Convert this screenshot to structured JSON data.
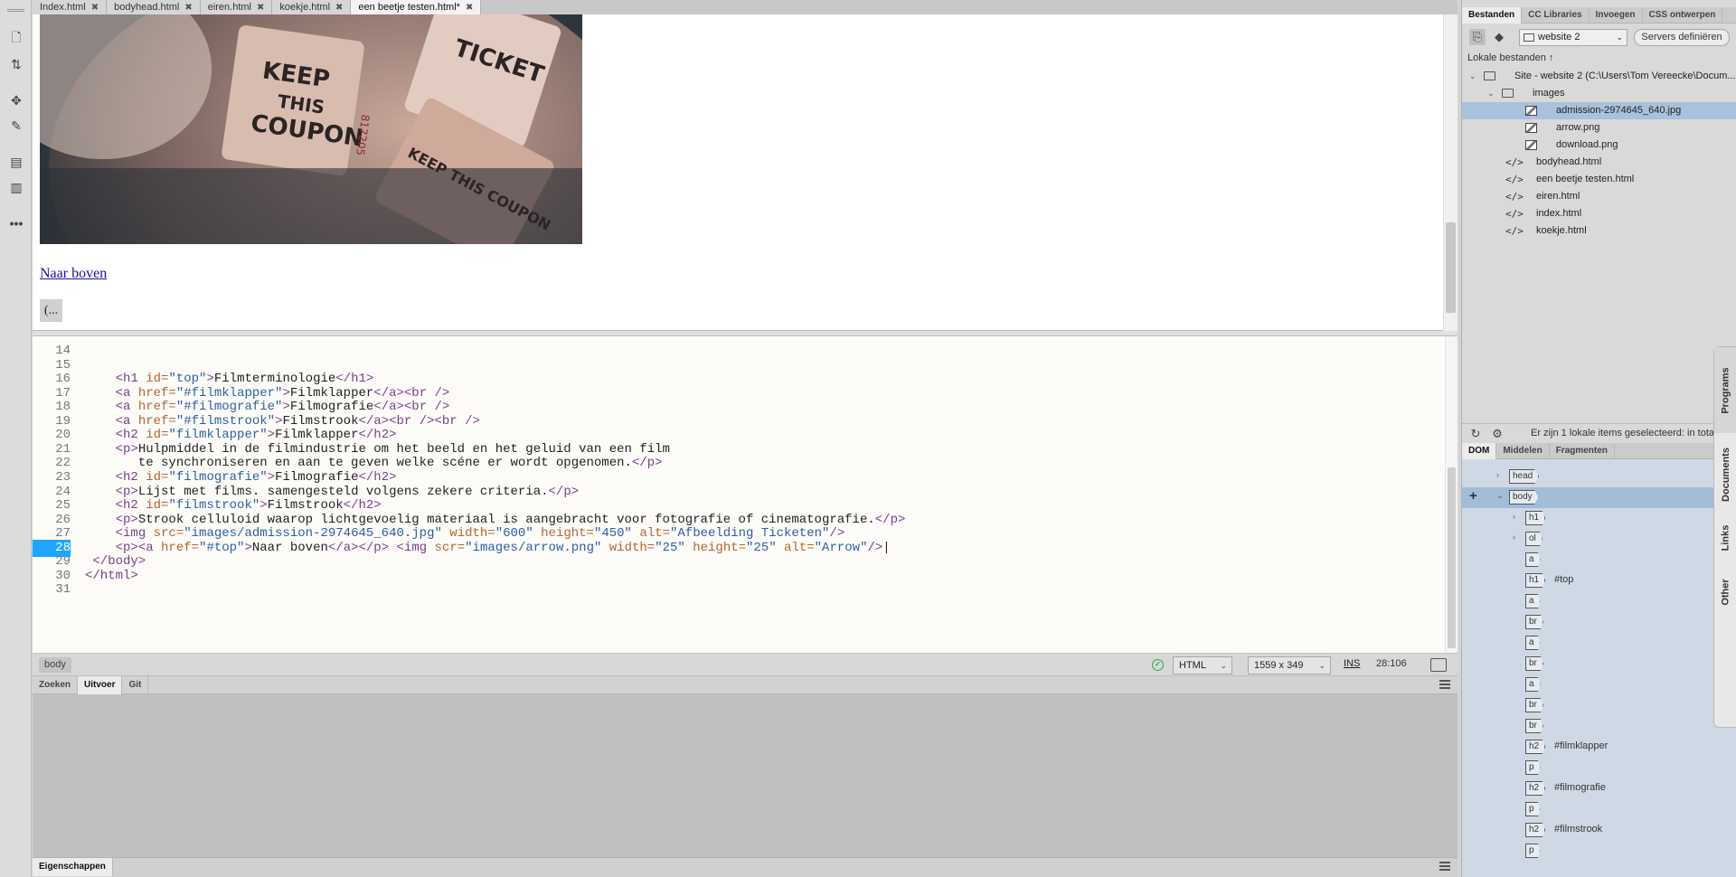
{
  "doc_tabs": [
    {
      "label": "Index.html",
      "active": false
    },
    {
      "label": "bodyhead.html",
      "active": false
    },
    {
      "label": "eiren.html",
      "active": false
    },
    {
      "label": "koekje.html",
      "active": false
    },
    {
      "label": "een beetje testen.html*",
      "active": true
    }
  ],
  "live": {
    "image_alt": "Afbeelding Ticketen",
    "image_text": [
      "KEEP",
      "THIS",
      "COUPON",
      "TICKET",
      "KEEP THIS COUPON",
      "817205"
    ],
    "link_text": "Naar boven",
    "arrow_button_text": "(..."
  },
  "code": {
    "lines": [
      {
        "n": "14",
        "html": ""
      },
      {
        "n": "15",
        "html": ""
      },
      {
        "n": "16",
        "html": "    <span class=\"tk-tag\">&lt;h1 </span><span class=\"tk-attr\">id=</span><span class=\"tk-val\">\"top\"</span><span class=\"tk-tag\">&gt;</span>Filmterminologie<span class=\"tk-tag\">&lt;/h1&gt;</span>"
      },
      {
        "n": "17",
        "html": "    <span class=\"tk-tag\">&lt;a </span><span class=\"tk-attr\">href=</span><span class=\"tk-val\">\"#filmklapper\"</span><span class=\"tk-tag\">&gt;</span>Filmklapper<span class=\"tk-tag\">&lt;/a&gt;&lt;br /&gt;</span>"
      },
      {
        "n": "18",
        "html": "    <span class=\"tk-tag\">&lt;a </span><span class=\"tk-attr\">href=</span><span class=\"tk-val\">\"#filmografie\"</span><span class=\"tk-tag\">&gt;</span>Filmografie<span class=\"tk-tag\">&lt;/a&gt;&lt;br /&gt;</span>"
      },
      {
        "n": "19",
        "html": "    <span class=\"tk-tag\">&lt;a </span><span class=\"tk-attr\">href=</span><span class=\"tk-val\">\"#filmstrook\"</span><span class=\"tk-tag\">&gt;</span>Filmstrook<span class=\"tk-tag\">&lt;/a&gt;&lt;br /&gt;&lt;br /&gt;</span>"
      },
      {
        "n": "20",
        "html": "    <span class=\"tk-tag\">&lt;h2 </span><span class=\"tk-attr\">id=</span><span class=\"tk-val\">\"filmklapper\"</span><span class=\"tk-tag\">&gt;</span>Filmklapper<span class=\"tk-tag\">&lt;/h2&gt;</span>"
      },
      {
        "n": "21",
        "html": "    <span class=\"tk-tag\">&lt;p&gt;</span>Hulpmiddel in de filmindustrie om het beeld en het geluid van een film"
      },
      {
        "n": "22",
        "html": "       te synchroniseren en aan te geven welke scéne er wordt opgenomen.<span class=\"tk-tag\">&lt;/p&gt;</span>"
      },
      {
        "n": "23",
        "html": "    <span class=\"tk-tag\">&lt;h2 </span><span class=\"tk-attr\">id=</span><span class=\"tk-val\">\"filmografie\"</span><span class=\"tk-tag\">&gt;</span>Filmografie<span class=\"tk-tag\">&lt;/h2&gt;</span>"
      },
      {
        "n": "24",
        "html": "    <span class=\"tk-tag\">&lt;p&gt;</span>Lijst met films. samengesteld volgens zekere criteria.<span class=\"tk-tag\">&lt;/p&gt;</span>"
      },
      {
        "n": "25",
        "html": "    <span class=\"tk-tag\">&lt;h2 </span><span class=\"tk-attr\">id=</span><span class=\"tk-val\">\"filmstrook\"</span><span class=\"tk-tag\">&gt;</span>Filmstrook<span class=\"tk-tag\">&lt;/h2&gt;</span>"
      },
      {
        "n": "26",
        "html": "    <span class=\"tk-tag\">&lt;p&gt;</span>Strook celluloid waarop lichtgevoelig materiaal is aangebracht voor fotografie of cinematografie.<span class=\"tk-tag\">&lt;/p&gt;</span>"
      },
      {
        "n": "27",
        "html": "    <span class=\"tk-tag\">&lt;img </span><span class=\"tk-attr\">src=</span><span class=\"tk-val\">\"images/admission-2974645_640.jpg\"</span> <span class=\"tk-attr\">width=</span><span class=\"tk-val\">\"600\"</span> <span class=\"tk-attr\">height=</span><span class=\"tk-val\">\"450\"</span> <span class=\"tk-attr\">alt=</span><span class=\"tk-val\">\"Afbeelding Ticketen\"</span><span class=\"tk-tag\">/&gt;</span>"
      },
      {
        "n": "28",
        "html": "    <span class=\"tk-tag\">&lt;p&gt;&lt;a </span><span class=\"tk-attr\">href=</span><span class=\"tk-val\">\"#top\"</span><span class=\"tk-tag\">&gt;</span>Naar boven<span class=\"tk-tag\">&lt;/a&gt;&lt;/p&gt;</span> <span class=\"tk-tag\">&lt;img </span><span class=\"tk-attr\">scr=</span><span class=\"tk-val\">\"images/arrow.png\"</span> <span class=\"tk-attr\">width=</span><span class=\"tk-val\">\"25\"</span> <span class=\"tk-attr\">height=</span><span class=\"tk-val\">\"25\"</span> <span class=\"tk-attr\">alt=</span><span class=\"tk-val\">\"Arrow\"</span><span class=\"tk-tag\">/&gt;</span>|",
        "current": true
      },
      {
        "n": "29",
        "html": " <span class=\"tk-tag\">&lt;/body&gt;</span>"
      },
      {
        "n": "30",
        "html": "<span class=\"tk-tag\">&lt;/html&gt;</span>"
      },
      {
        "n": "31",
        "html": ""
      }
    ]
  },
  "status_bar": {
    "tag": "body",
    "language": "HTML",
    "size": "1559 x 349",
    "mode": "INS",
    "position": "28:106"
  },
  "output_tabs": [
    {
      "label": "Zoeken",
      "active": false
    },
    {
      "label": "Uitvoer",
      "active": true
    },
    {
      "label": "Git",
      "active": false
    }
  ],
  "properties_tab": "Eigenschappen",
  "right_panel": {
    "tabs": [
      {
        "label": "Bestanden",
        "active": true
      },
      {
        "label": "CC Libraries",
        "active": false
      },
      {
        "label": "Invoegen",
        "active": false
      },
      {
        "label": "CSS ontwerpen",
        "active": false
      }
    ],
    "site_select": "website 2",
    "servers_button": "Servers definiëren",
    "local_files_label": "Lokale bestanden ↑",
    "tree": [
      {
        "label": "Site - website 2 (C:\\Users\\Tom Vereecke\\Docum...",
        "type": "folder",
        "level": 0,
        "expanded": true
      },
      {
        "label": "images",
        "type": "folder",
        "level": 1,
        "expanded": true
      },
      {
        "label": "admission-2974645_640.jpg",
        "type": "image",
        "level": 2,
        "selected": true
      },
      {
        "label": "arrow.png",
        "type": "image",
        "level": 2
      },
      {
        "label": "download.png",
        "type": "image",
        "level": 2
      },
      {
        "label": "bodyhead.html",
        "type": "code",
        "level": 1
      },
      {
        "label": "een beetje testen.html",
        "type": "code",
        "level": 1
      },
      {
        "label": "eiren.html",
        "type": "code",
        "level": 1
      },
      {
        "label": "index.html",
        "type": "code",
        "level": 1
      },
      {
        "label": "koekje.html",
        "type": "code",
        "level": 1
      }
    ],
    "footer_status": "Er zijn 1 lokale items geselecteerd: in totaa",
    "dom_tabs": [
      {
        "label": "DOM",
        "active": true
      },
      {
        "label": "Middelen",
        "active": false
      },
      {
        "label": "Fragmenten",
        "active": false
      }
    ],
    "dom": [
      {
        "tag": "head",
        "level": 1,
        "chev": "›"
      },
      {
        "tag": "body",
        "level": 1,
        "chev": "⌄",
        "selected": true
      },
      {
        "tag": "h1",
        "level": 2,
        "chev": "›"
      },
      {
        "tag": "ol",
        "level": 2,
        "chev": "›"
      },
      {
        "tag": "a",
        "level": 2
      },
      {
        "tag": "h1",
        "level": 2,
        "id": "#top"
      },
      {
        "tag": "a",
        "level": 2
      },
      {
        "tag": "br",
        "level": 2
      },
      {
        "tag": "a",
        "level": 2
      },
      {
        "tag": "br",
        "level": 2
      },
      {
        "tag": "a",
        "level": 2
      },
      {
        "tag": "br",
        "level": 2
      },
      {
        "tag": "br",
        "level": 2
      },
      {
        "tag": "h2",
        "level": 2,
        "id": "#filmklapper"
      },
      {
        "tag": "p",
        "level": 2
      },
      {
        "tag": "h2",
        "level": 2,
        "id": "#filmografie"
      },
      {
        "tag": "p",
        "level": 2
      },
      {
        "tag": "h2",
        "level": 2,
        "id": "#filmstrook"
      },
      {
        "tag": "p",
        "level": 2
      }
    ],
    "side_tabs": [
      "Programs",
      "Documents",
      "Links",
      "Other"
    ]
  }
}
